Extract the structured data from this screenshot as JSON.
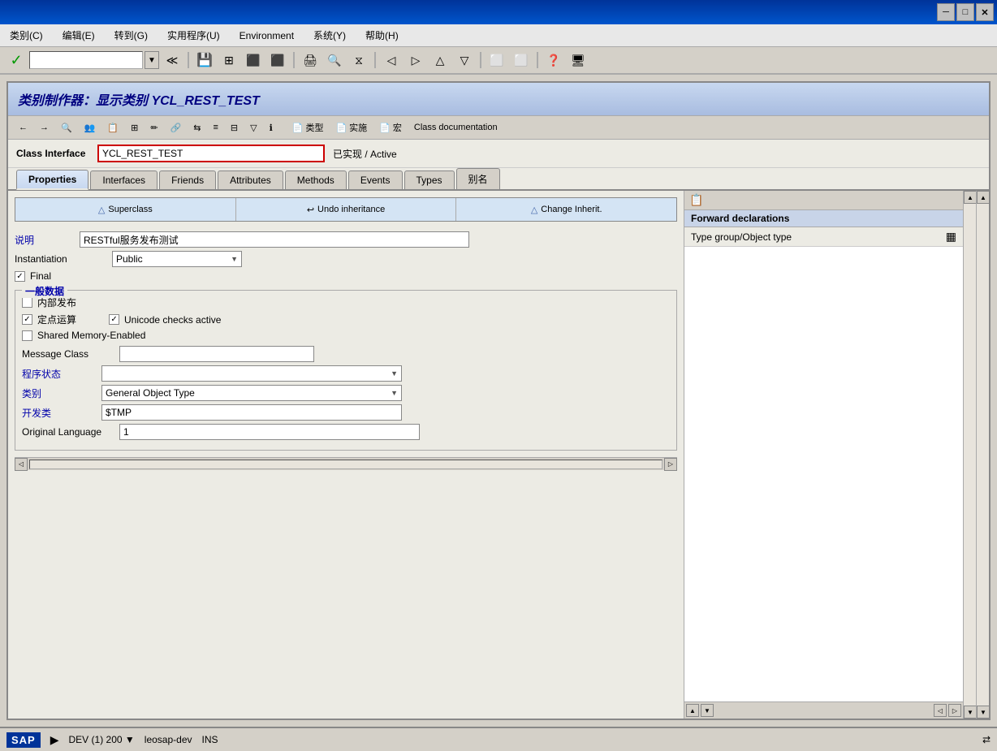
{
  "titlebar": {
    "minimize": "─",
    "maximize": "□",
    "close": "✕"
  },
  "menubar": {
    "items": [
      {
        "id": "lei-bie",
        "label": "类别(C)"
      },
      {
        "id": "bian-ji",
        "label": "编辑(E)"
      },
      {
        "id": "zhuan-dao",
        "label": "转到(G)"
      },
      {
        "id": "shi-yong-cheng-xu",
        "label": "实用程序(U)"
      },
      {
        "id": "environment",
        "label": "Environment"
      },
      {
        "id": "xi-tong",
        "label": "系统(Y)"
      },
      {
        "id": "bang-zhu",
        "label": "帮助(H)"
      }
    ]
  },
  "window_title": "类别制作器：显示类别 YCL_REST_TEST",
  "class_interface": {
    "label": "Class Interface",
    "value": "YCL_REST_TEST",
    "status": "已实现 / Active"
  },
  "tabs": [
    {
      "id": "properties",
      "label": "Properties",
      "active": true
    },
    {
      "id": "interfaces",
      "label": "Interfaces"
    },
    {
      "id": "friends",
      "label": "Friends"
    },
    {
      "id": "attributes",
      "label": "Attributes"
    },
    {
      "id": "methods",
      "label": "Methods"
    },
    {
      "id": "events",
      "label": "Events"
    },
    {
      "id": "types",
      "label": "Types"
    },
    {
      "id": "aliases",
      "label": "别名"
    }
  ],
  "inheritance": {
    "superclass_btn": "Superclass",
    "undo_btn": "Undo inheritance",
    "change_btn": "Change Inherit."
  },
  "form": {
    "description_label": "说明",
    "description_value": "RESTful服务发布测试",
    "instantiation_label": "Instantiation",
    "instantiation_value": "Public",
    "final_label": "Final",
    "final_checked": true,
    "general_data_group": "一般数据",
    "internal_publish_label": "内部发布",
    "internal_publish_checked": false,
    "fixed_point_label": "定点运算",
    "fixed_point_checked": true,
    "unicode_label": "Unicode checks active",
    "unicode_checked": true,
    "shared_memory_label": "Shared Memory-Enabled",
    "shared_memory_checked": false,
    "message_class_label": "Message Class",
    "message_class_value": "",
    "program_status_label": "程序状态",
    "program_status_value": "",
    "category_label": "类别",
    "category_value": "General Object Type",
    "dev_class_label": "开发类",
    "dev_class_value": "$TMP",
    "original_lang_label": "Original Language",
    "original_lang_value": "1"
  },
  "right_panel": {
    "forward_declarations": "Forward declarations",
    "type_group_header": "Type group/Object type",
    "icon_label": "▦"
  },
  "statusbar": {
    "sap_logo": "SAP",
    "play_icon": "▶",
    "system": "DEV (1) 200",
    "dropdown": "▼",
    "server": "leosap-dev",
    "mode": "INS",
    "nav_icon": "⇄"
  },
  "toolbar": {
    "check_icon": "✓",
    "back_icon": "←",
    "forward_icon": "→",
    "save_icon": "💾",
    "find_icon": "🔍",
    "print_icon": "🖨"
  },
  "inner_toolbar": {
    "class_type_label": "类型",
    "implementation_label": "实施",
    "macro_label": "宏",
    "class_doc_label": "Class documentation"
  }
}
